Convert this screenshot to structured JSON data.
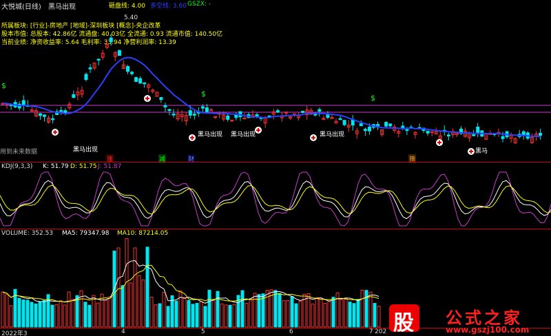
{
  "header": {
    "title": "大悦城(日线)",
    "indicator_name": "黑马出现",
    "param1_label": "砸盘线: 4.00",
    "param2_label": "多空线: 3.60",
    "param3_label": "GSZX: -",
    "price_tag": "5.40"
  },
  "info": {
    "line1": "所属板块: [行业]-房地产 [地域]-深圳板块 [概念]-央企改革",
    "line2": "股本市值: 总股本: 42.86亿 流通盘: 40.03亿 全流通: 0.93 流通市值: 140.50亿",
    "line3": "当前业绩: 净资收益率: 5.64 毛利率: 33.94 净营利润率: 13.39",
    "future_note": "用到未来数据"
  },
  "signals": {
    "dollar": "$",
    "heima": "黑马出现",
    "heima_short": "黑马",
    "markers": [
      "涨",
      "减",
      "财",
      "筛"
    ]
  },
  "kdj": {
    "label": "KDJ(9,3,3)",
    "k": "K: 51.79",
    "d": "D: 51.75",
    "j": "J: 51.87"
  },
  "volume": {
    "label": "VOLUME: 352.53",
    "ma5": "MA5: 79347.98",
    "ma10": "MA10: 87214.05"
  },
  "xaxis": {
    "labels": [
      "2022年3",
      "4",
      "5",
      "6",
      "7",
      "202"
    ]
  },
  "watermark": {
    "logo_char": "股",
    "brand": "公式之家",
    "url": "www.gszj100.com"
  },
  "colors": {
    "up": "#ff3232",
    "down": "#00e5ee",
    "ma": "#2b40ff",
    "kline": "#ffffff",
    "dline": "#ffff00",
    "jline": "#c83cc8"
  }
}
